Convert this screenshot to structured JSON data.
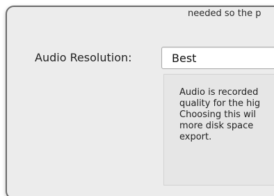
{
  "top_partial_text": "needed so the p",
  "audio_resolution": {
    "label": "Audio Resolution:",
    "value": "Best"
  },
  "description": {
    "lines": [
      "Audio is recorded",
      "quality for the hig",
      "Choosing this wil",
      "more disk space",
      "export."
    ]
  }
}
